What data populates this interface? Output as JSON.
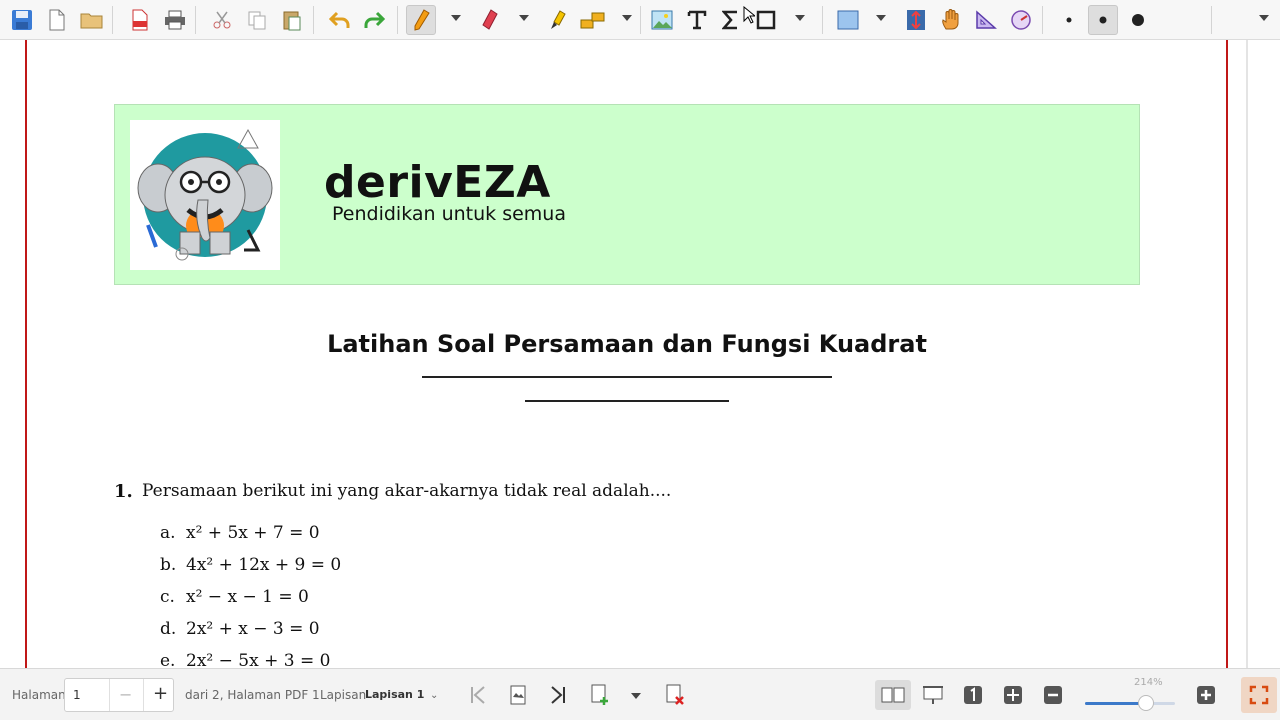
{
  "toolbar": {
    "icons": [
      "save-icon",
      "new-icon",
      "open-icon",
      "export-pdf-icon",
      "print-icon",
      "cut-icon",
      "copy-icon",
      "paste-icon",
      "undo-icon",
      "redo-icon",
      "pen-icon",
      "eraser-icon",
      "highlighter-icon",
      "select-region-icon",
      "image-icon",
      "text-icon",
      "formula-icon",
      "shape-icon",
      "rectangle-icon",
      "vertical-space-icon",
      "hand-icon",
      "set-square-icon",
      "compass-icon",
      "thin-dot-icon",
      "medium-dot-icon",
      "thick-dot-icon",
      "color-icon"
    ]
  },
  "document": {
    "brand": "derivEZA",
    "tagline": "Pendidikan untuk semua",
    "title": "Latihan Soal Persamaan dan Fungsi Kuadrat",
    "question": {
      "number": "1.",
      "text": "Persamaan berikut ini yang akar-akarnya tidak real adalah....",
      "options": [
        {
          "label": "a.",
          "expr": "x² + 5x + 7 = 0"
        },
        {
          "label": "b.",
          "expr": "4x² + 12x + 9 = 0"
        },
        {
          "label": "c.",
          "expr": "x² − x − 1 = 0"
        },
        {
          "label": "d.",
          "expr": "2x² + x − 3 = 0"
        },
        {
          "label": "e.",
          "expr": "2x² − 5x + 3 = 0"
        }
      ]
    }
  },
  "bottombar": {
    "page_label": "Halaman",
    "page_value": "1",
    "page_minus": "−",
    "page_plus": "+",
    "page_info": "dari 2, Halaman PDF 1",
    "layer_label": "Lapisan",
    "layer_value": "Lapisan 1",
    "layer_chevron": "⌄",
    "zoom_label": "214%",
    "zoom_fraction": 0.68
  },
  "colors": {
    "banner_bg": "#ccffcc",
    "page_border": "#c01818",
    "accent": "#3b79c9"
  }
}
